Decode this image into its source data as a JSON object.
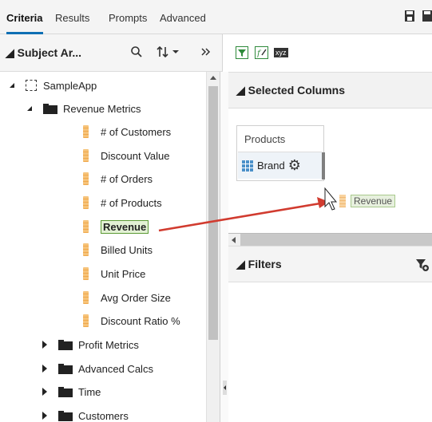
{
  "tabs": [
    "Criteria",
    "Results",
    "Prompts",
    "Advanced"
  ],
  "subject_area": {
    "title": "Subject Ar...",
    "search_icon": "search-icon",
    "sort_icon": "sort-icon",
    "collapse_icon": "double-chevron-right-icon"
  },
  "tree": {
    "root": "SampleApp",
    "folders": {
      "revenue_metrics": "Revenue Metrics",
      "profit_metrics": "Profit Metrics",
      "advanced_calcs": "Advanced Calcs",
      "time": "Time",
      "customers": "Customers"
    },
    "measures": [
      "# of Customers",
      "Discount Value",
      "# of Orders",
      "# of Products",
      "Revenue",
      "Billed Units",
      "Unit Price",
      "Avg Order Size",
      "Discount Ratio %"
    ],
    "selected_measure": "Revenue"
  },
  "right_toolbar": {
    "filter_icon": "filter-icon",
    "edit_icon": "edit-formula-icon",
    "xyz_label": "xyz"
  },
  "selected_columns": {
    "title": "Selected Columns",
    "table": "Products",
    "column": "Brand",
    "drag_label": "Revenue"
  },
  "filters": {
    "title": "Filters"
  },
  "colors": {
    "accent": "#0f6fb4",
    "arrow": "#d13b2f",
    "highlight": "#e3f1d5",
    "measure": "#f0a84a"
  }
}
